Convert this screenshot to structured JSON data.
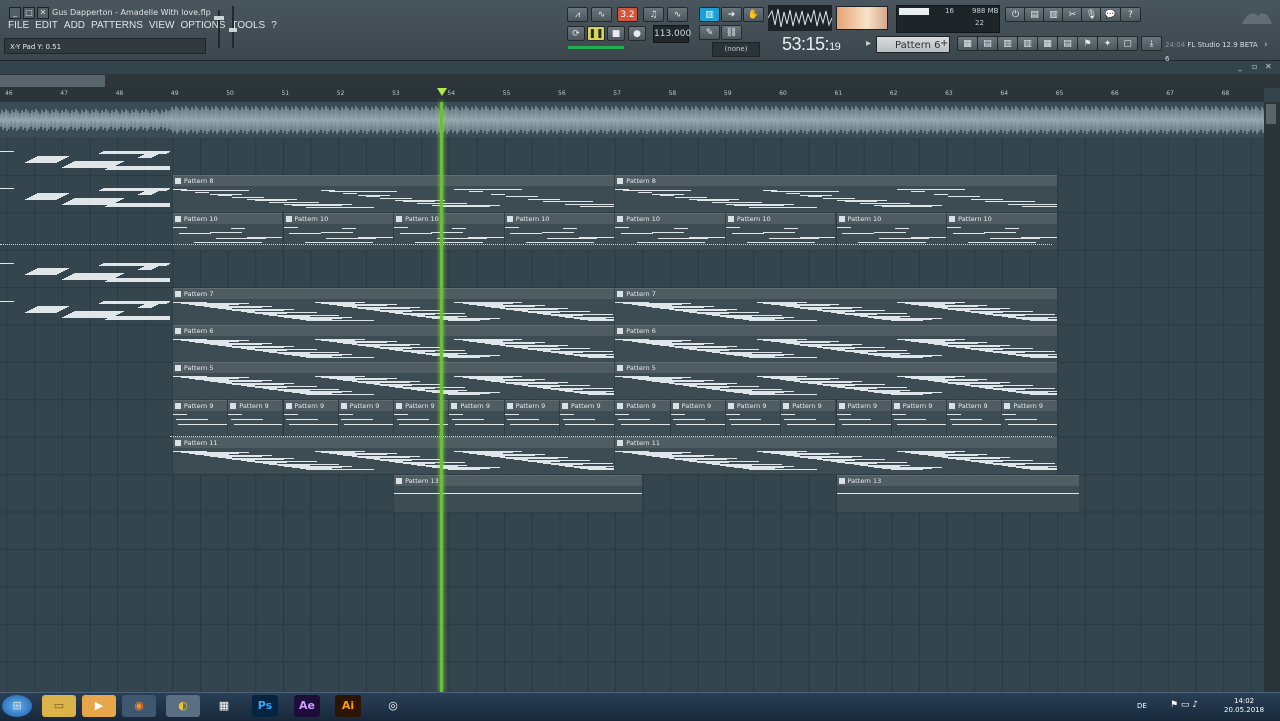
{
  "window": {
    "title": "Gus Dapperton - Amadelle With love.flp"
  },
  "menu": [
    "FILE",
    "EDIT",
    "ADD",
    "PATTERNS",
    "VIEW",
    "OPTIONS",
    "TOOLS",
    "?"
  ],
  "hint": "X-Y Pad Y: 0.51",
  "transport": {
    "bpm": "113.000",
    "time_main": "53:15",
    "time_sub": "19",
    "pattern": "Pattern 6",
    "none_label": "(none)",
    "song_mode_label": "3.2"
  },
  "cpu": {
    "value1": "16",
    "memory": "988 MB",
    "value2": "22"
  },
  "app_hint": {
    "time": "24:04",
    "label": "FL Studio 12.9 BETA 6"
  },
  "ruler": [
    "46",
    "47",
    "48",
    "49",
    "50",
    "51",
    "52",
    "53",
    "54",
    "55",
    "56",
    "57",
    "58",
    "59",
    "60",
    "61",
    "62",
    "63",
    "64",
    "65",
    "66",
    "67",
    "68"
  ],
  "playlist": {
    "clips": [
      {
        "label": "Pattern 8",
        "lane": 1
      },
      {
        "label": "Pattern 10",
        "lane": 2
      },
      {
        "label": "Pattern 7",
        "lane": 4
      },
      {
        "label": "Pattern 6",
        "lane": 5
      },
      {
        "label": "Pattern 5",
        "lane": 6
      },
      {
        "label": "Pattern 9",
        "lane": 7
      },
      {
        "label": "Pattern 11",
        "lane": 8
      },
      {
        "label": "Pattern 13",
        "lane": 9
      }
    ]
  },
  "taskbar": {
    "lang": "DE",
    "time": "14:02",
    "date": "20.05.2018",
    "apps": [
      "start",
      "explorer",
      "media",
      "firefox",
      "fl-studio",
      "film",
      "Ps",
      "Ae",
      "Ai",
      "cinema4d"
    ]
  },
  "colors": {
    "playhead": "#6ac036",
    "background": "#34454e",
    "accent": "#d0573d"
  }
}
